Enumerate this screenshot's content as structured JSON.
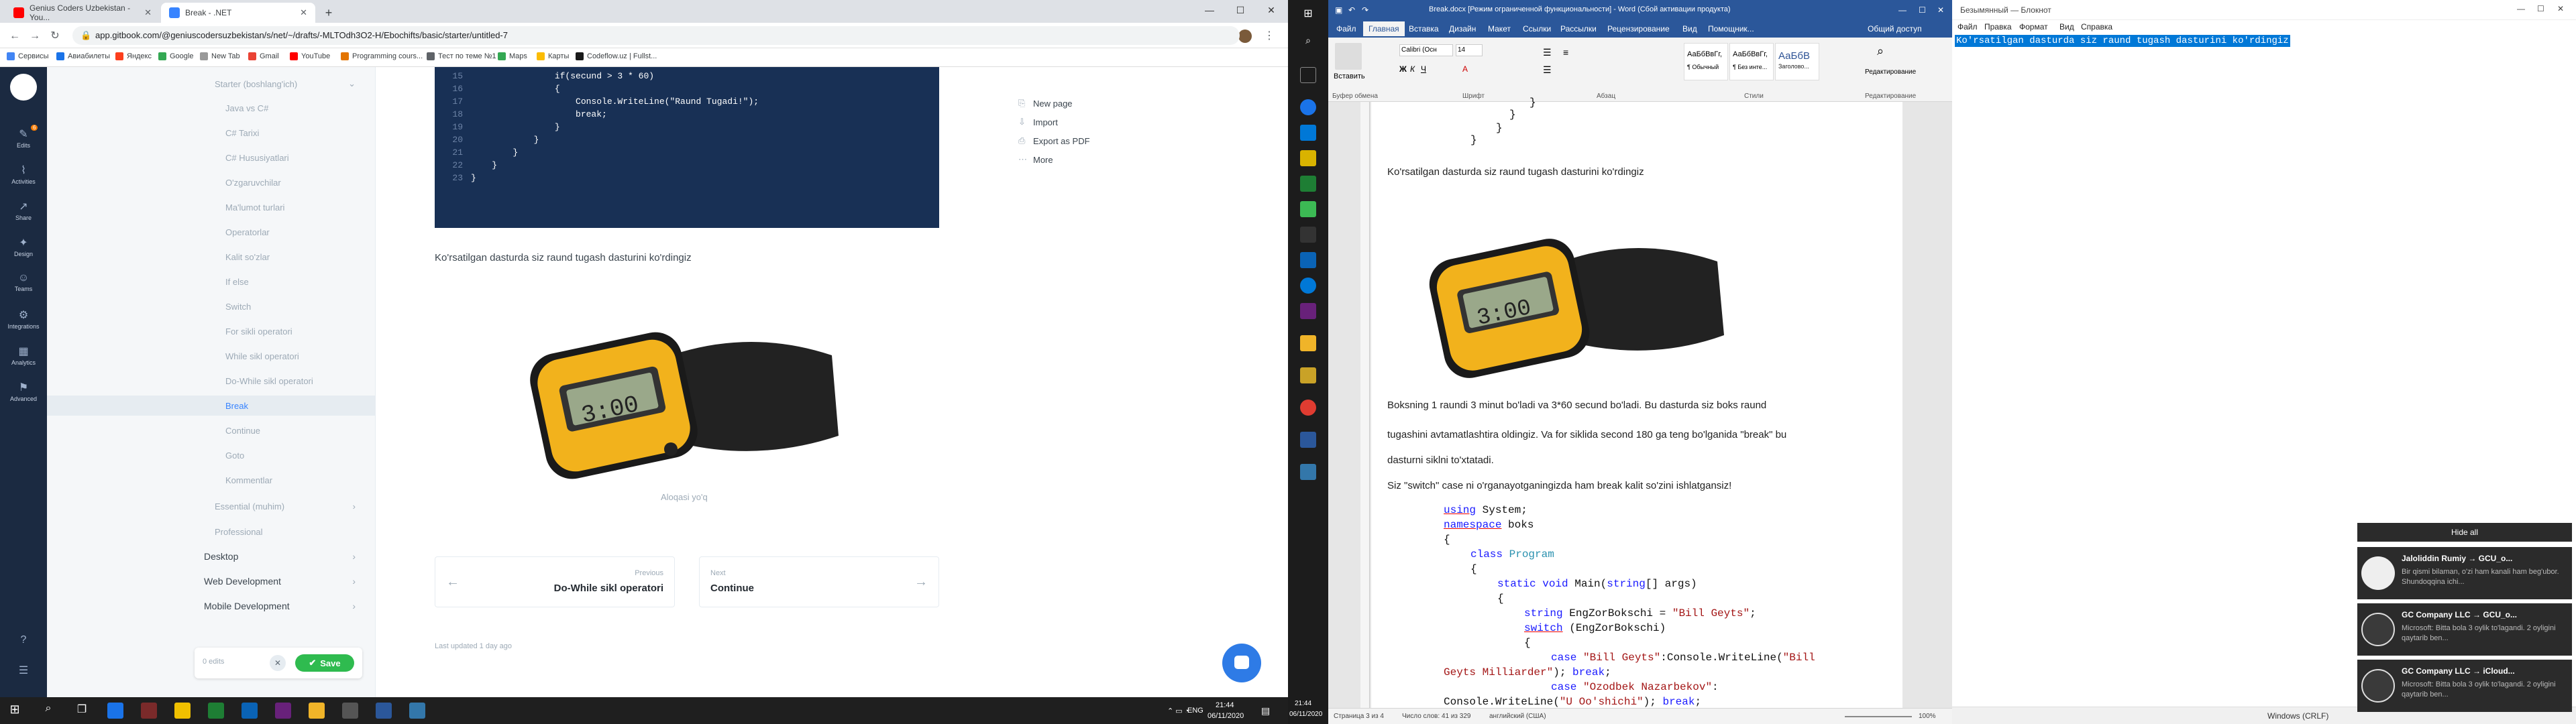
{
  "chrome": {
    "tabs": [
      {
        "label": "Genius Coders Uzbekistan - You..."
      },
      {
        "label": "Break - .NET"
      }
    ],
    "url": "app.gitbook.com/@geniuscodersuzbekistan/s/net/~/drafts/-MLTOdh3O2-H/Ebochifts/basic/starter/untitled-7",
    "bookmarks": [
      "Сервисы",
      "Авиабилеты",
      "Яндекс",
      "Google",
      "New Tab",
      "Gmail",
      "YouTube",
      "Programming cours...",
      "Тест по теме №1 |...",
      "Maps",
      "Карты",
      "Codeflow.uz | Fullst..."
    ]
  },
  "gitbook": {
    "rail": [
      {
        "label": "Edits",
        "badge": "6"
      },
      {
        "label": "Activities"
      },
      {
        "label": "Share"
      },
      {
        "label": "Design"
      },
      {
        "label": "Teams"
      },
      {
        "label": "Integrations"
      },
      {
        "label": "Analytics"
      },
      {
        "label": "Advanced"
      }
    ],
    "nav_section": "Starter (boshlang'ich)",
    "nav_items": [
      "Java vs C#",
      "C# Tarixi",
      "C# Hususiyatlari",
      "O'zgaruvchilar",
      "Ma'lumot turlari",
      "Operatorlar",
      "Kalit so'zlar",
      "If else",
      "Switch",
      "For sikli operatori",
      "While sikl operatori",
      "Do-While sikl operatori",
      "Break",
      "Continue",
      "Goto",
      "Kommentlar"
    ],
    "nav_active": "Break",
    "nav_lower": [
      {
        "label": "Essential (muhim)"
      },
      {
        "label": "Professional"
      }
    ],
    "nav_top": [
      "Desktop",
      "Web Development",
      "Mobile Development"
    ],
    "edits_label": "0 edits",
    "save_label": "Save",
    "code_lines": [
      {
        "n": "15",
        "code": "                if(secund > 3 * 60)"
      },
      {
        "n": "16",
        "code": "                {"
      },
      {
        "n": "17",
        "code": "                    Console.WriteLine(\"Raund Tugadi!\");"
      },
      {
        "n": "18",
        "code": "                    break;"
      },
      {
        "n": "19",
        "code": "                }"
      },
      {
        "n": "20",
        "code": "            }"
      },
      {
        "n": "21",
        "code": "        }"
      },
      {
        "n": "22",
        "code": "    }"
      },
      {
        "n": "23",
        "code": "}"
      }
    ],
    "page_menu": [
      "New page",
      "Import",
      "Export as PDF",
      "More"
    ],
    "paragraph": "Ko'rsatilgan dasturda siz raund tugash dasturini ko'rdingiz",
    "caption": "Aloqasi yo'q",
    "prev": {
      "small": "Previous",
      "title": "Do-While sikl operatori"
    },
    "next": {
      "small": "Next",
      "title": "Continue"
    },
    "last_updated": "Last updated 1 day ago"
  },
  "taskbar": {
    "lang": "ENG",
    "time": "21:44",
    "date": "06/11/2020"
  },
  "word": {
    "title": "Break.docx [Режим ограниченной функциональности] - Word (Сбой активации продукта)",
    "tabs": [
      "Файл",
      "Главная",
      "Вставка",
      "Дизайн",
      "Макет",
      "Ссылки",
      "Рассылки",
      "Рецензирование",
      "Вид",
      "Помощник...",
      "Общий доступ"
    ],
    "active_tab": "Главная",
    "font_name": "Calibri (Осн",
    "font_size": "14",
    "groups": [
      "Буфер обмена",
      "Шрифт",
      "Абзац",
      "Стили",
      "Редактирование"
    ],
    "paste_label": "Вставить",
    "styles": [
      {
        "sample": "АаБбВвГг,",
        "label": "¶ Обычный"
      },
      {
        "sample": "АаБбВвГг,",
        "label": "¶ Без инте..."
      },
      {
        "sample": "АаБбВ",
        "label": "Заголово..."
      }
    ],
    "edit_label": "Редактирование",
    "top_braces": [
      "}",
      "}",
      "}",
      "}"
    ],
    "para1": "Ko'rsatilgan dasturda siz raund tugash dasturini ko'rdingiz",
    "para2a": "Boksning 1 raundi 3 minut bo'ladi va 3*60 secund bo'ladi. Bu dasturda siz boks raund",
    "para2b": "tugashini avtamatlashtira oldingiz. Va for siklida second 180 ga teng bo'lganida \"break\" bu",
    "para2c": "dasturni siklni to'xtatadi.",
    "para3": "Siz \"switch\" case ni o'rganayotganingizda ham break kalit so'zini ishlatgansiz!",
    "code": {
      "l1a": "using",
      "l1b": " System;",
      "l2a": "namespace",
      "l2b": " boks",
      "l3": "{",
      "l4a": "class",
      "l4b": "Program",
      "l5": "{",
      "l6a": "static",
      "l6b": "void",
      "l6c": " Main(",
      "l6d": "string",
      "l6e": "[] args)",
      "l7": "{",
      "l8a": "string",
      "l8b": " EngZorBokschi = ",
      "l8c": "\"Bill Geyts\"",
      "l8d": ";",
      "l9a": "switch",
      "l9b": " (EngZorBokschi)",
      "l10": "{",
      "l11a": "case",
      "l11b": "\"Bill Geyts\"",
      "l11c": ":Console.WriteLine(",
      "l11d": "\"Bill",
      "l12a": "Geyts Milliarder\"",
      "l12b": "); ",
      "l12c": "break",
      "l12d": ";",
      "l13a": "case",
      "l13b": "\"Ozodbek Nazarbekov\"",
      "l13c": ":",
      "l14a": "Console.WriteLine(",
      "l14b": "\"U Oo'shichi\"",
      "l14c": "); ",
      "l14d": "break",
      "l14e": ";"
    },
    "status": {
      "page": "Страница 3 из 4",
      "words": "Число слов: 41 из 329",
      "lang": "английский (США)",
      "zoom": "100%"
    }
  },
  "notepad": {
    "title": "Безымянный — Блокнот",
    "menu": [
      "Файл",
      "Правка",
      "Формат",
      "Вид",
      "Справка"
    ],
    "selected_text": "Ko'rsatilgan dasturda siz raund tugash dasturini ko'rdingiz",
    "status_enc": "Windows (CRLF)"
  },
  "notifications": {
    "hide_all": "Hide all",
    "items": [
      {
        "title": "Jaloliddin Rumiy → GCU_o...",
        "body": "Bir qismi bilaman, o'zi ham kanali ham beg'ubor. Shundoqqina ichi..."
      },
      {
        "title": "GC Company LLC → GCU_o...",
        "body": "Microsoft: Bitta bola 3 oylik to'lagandi. 2 oyligini qaytarib ben..."
      },
      {
        "title": "GC Company LLC → iCloud...",
        "body": "Microsoft: Bitta bola 3 oylik to'lagandi. 2 oyligini qaytarib ben..."
      }
    ]
  }
}
